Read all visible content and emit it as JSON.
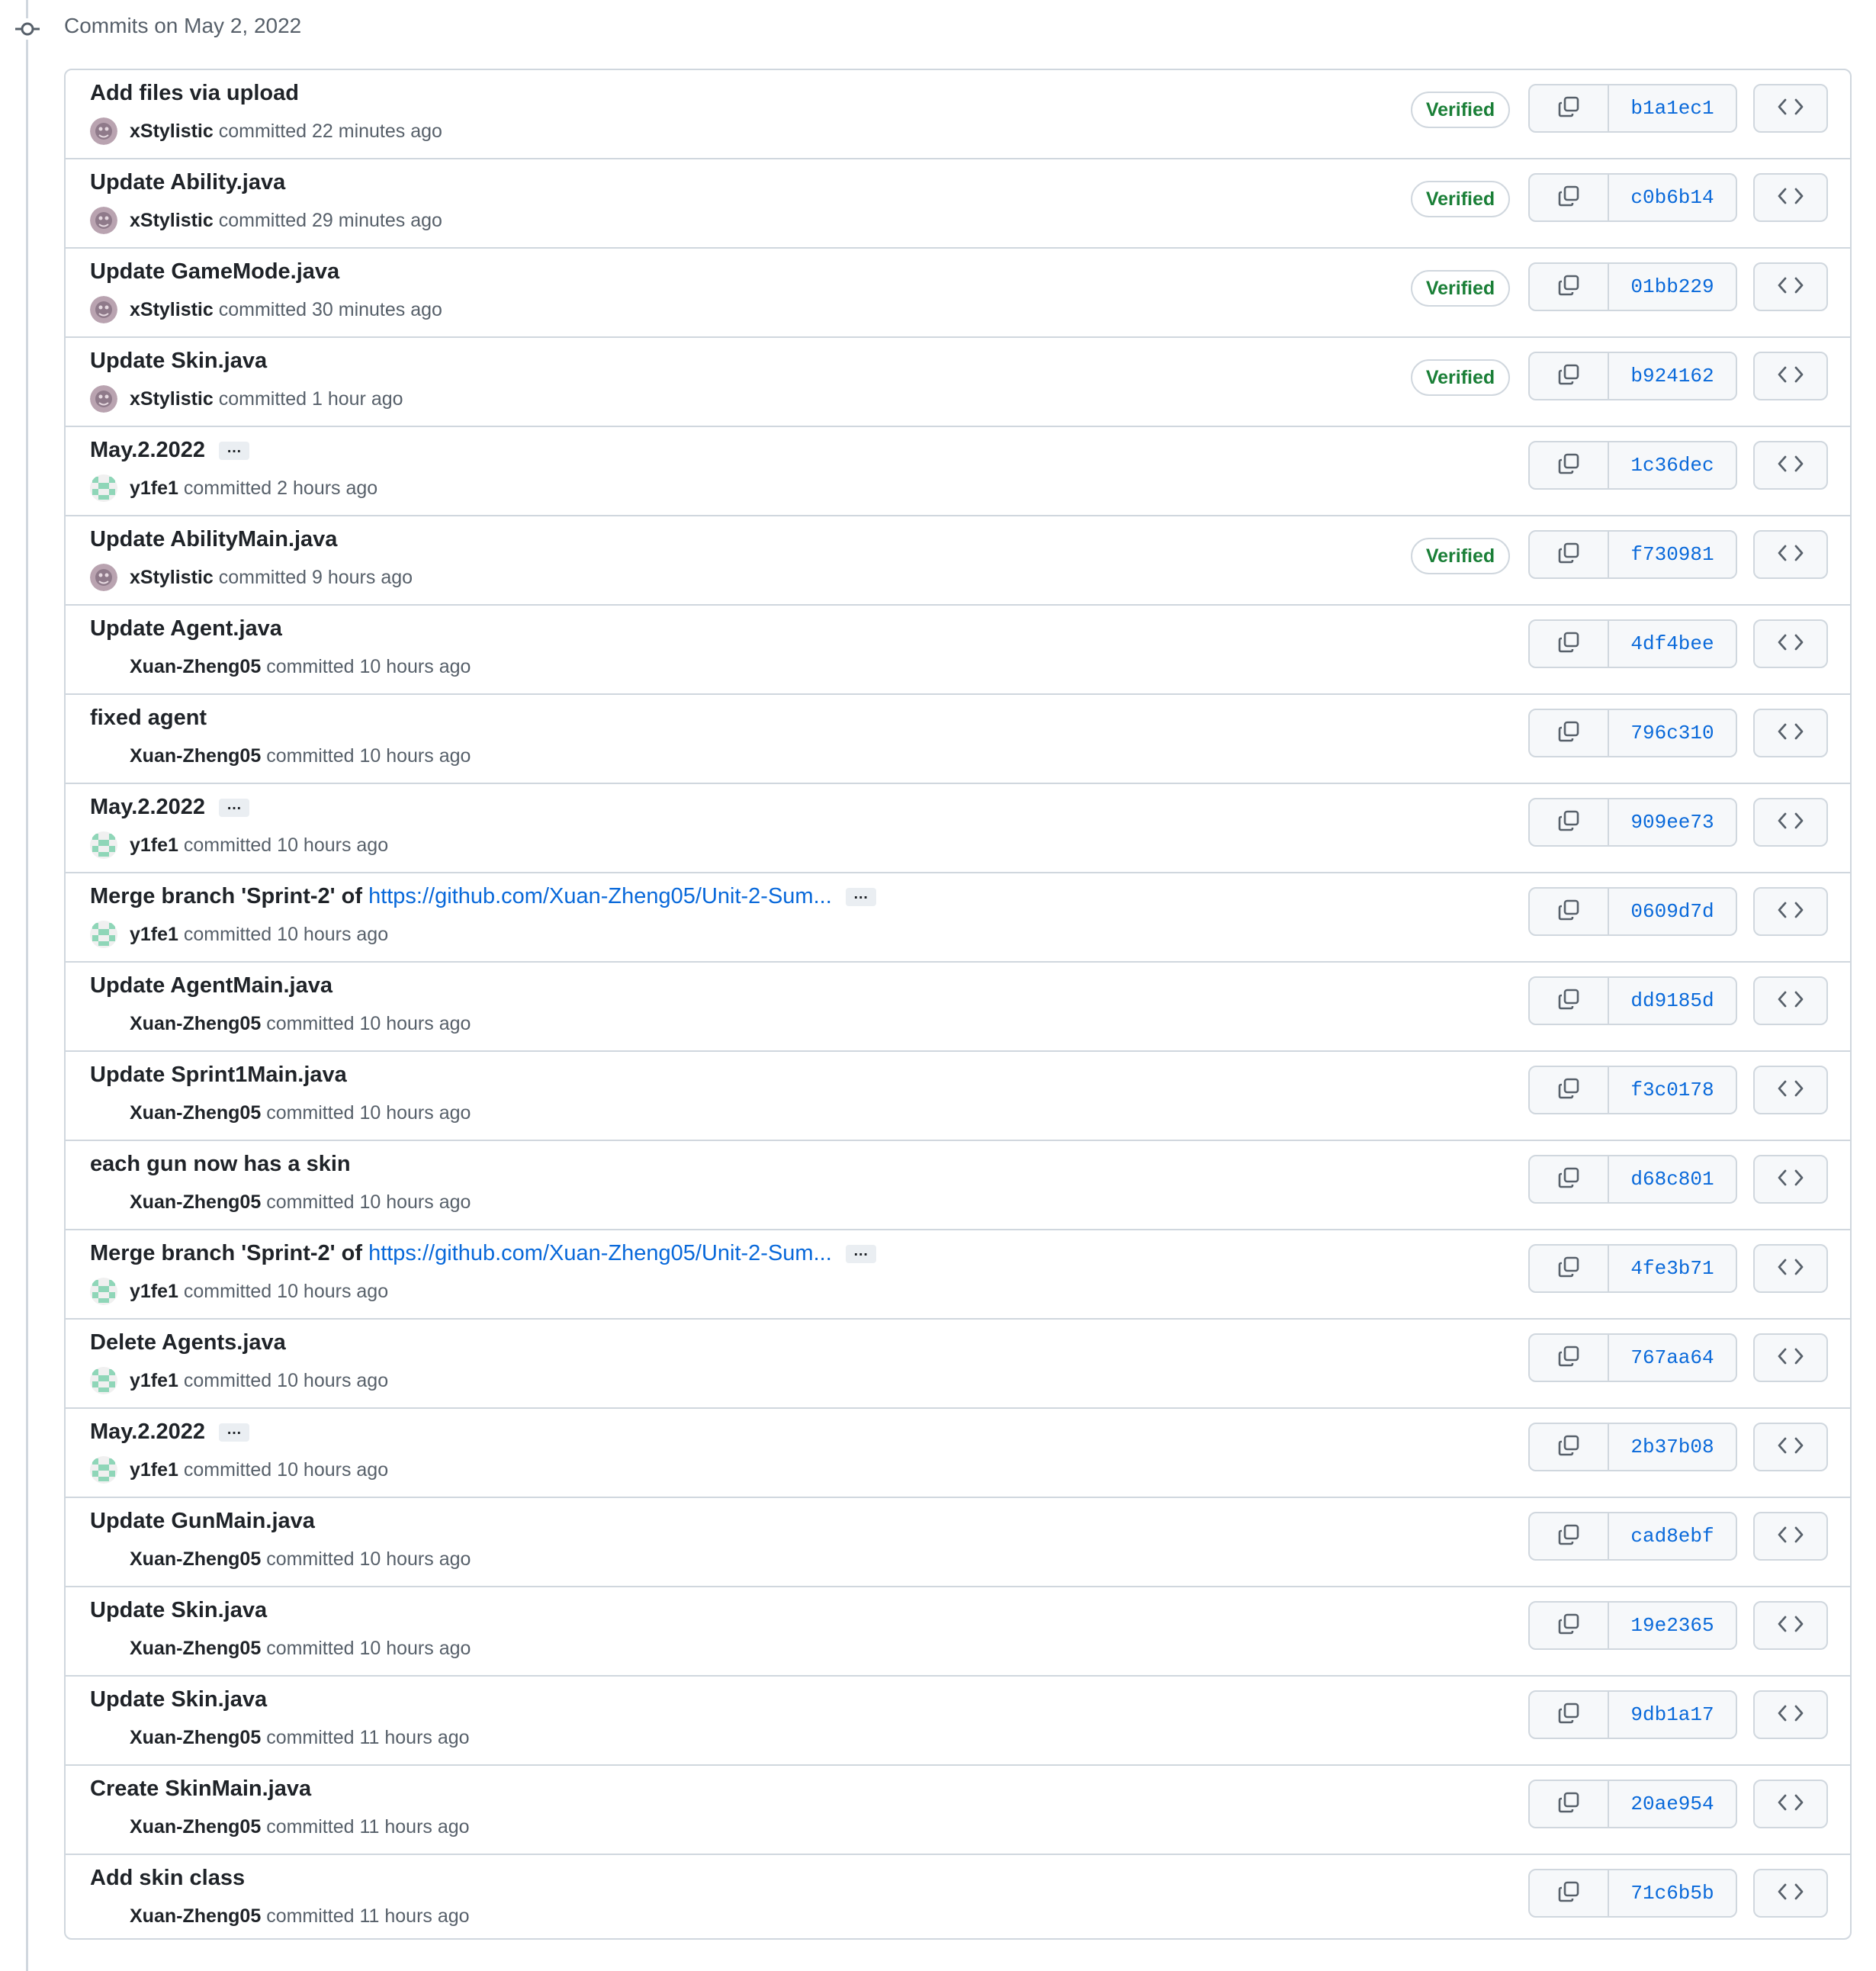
{
  "group": {
    "header": "Commits on May 2, 2022"
  },
  "verified_label": "Verified",
  "colors": {
    "link": "#0969da",
    "verified": "#1a7f37",
    "muted": "#57606a",
    "border": "#d0d7de"
  },
  "icons": {
    "timeline": "git-commit-icon",
    "copy": "copy-icon",
    "browse": "code-icon",
    "more": "kebab-ellipsis-icon"
  },
  "commits": [
    {
      "title": "Add files via upload",
      "link": "",
      "more": false,
      "author": "xStylistic",
      "time": "committed 22 minutes ago",
      "verified": true,
      "sha": "b1a1ec1",
      "avatar": "xstylistic"
    },
    {
      "title": "Update Ability.java",
      "link": "",
      "more": false,
      "author": "xStylistic",
      "time": "committed 29 minutes ago",
      "verified": true,
      "sha": "c0b6b14",
      "avatar": "xstylistic"
    },
    {
      "title": "Update GameMode.java",
      "link": "",
      "more": false,
      "author": "xStylistic",
      "time": "committed 30 minutes ago",
      "verified": true,
      "sha": "01bb229",
      "avatar": "xstylistic"
    },
    {
      "title": "Update Skin.java",
      "link": "",
      "more": false,
      "author": "xStylistic",
      "time": "committed 1 hour ago",
      "verified": true,
      "sha": "b924162",
      "avatar": "xstylistic"
    },
    {
      "title": "May.2.2022",
      "link": "",
      "more": true,
      "author": "y1fe1",
      "time": "committed 2 hours ago",
      "verified": false,
      "sha": "1c36dec",
      "avatar": "y1fe1"
    },
    {
      "title": "Update AbilityMain.java",
      "link": "",
      "more": false,
      "author": "xStylistic",
      "time": "committed 9 hours ago",
      "verified": true,
      "sha": "f730981",
      "avatar": "xstylistic"
    },
    {
      "title": "Update Agent.java",
      "link": "",
      "more": false,
      "author": "Xuan-Zheng05",
      "time": "committed 10 hours ago",
      "verified": false,
      "sha": "4df4bee",
      "avatar": "none"
    },
    {
      "title": "fixed agent",
      "link": "",
      "more": false,
      "author": "Xuan-Zheng05",
      "time": "committed 10 hours ago",
      "verified": false,
      "sha": "796c310",
      "avatar": "none"
    },
    {
      "title": "May.2.2022",
      "link": "",
      "more": true,
      "author": "y1fe1",
      "time": "committed 10 hours ago",
      "verified": false,
      "sha": "909ee73",
      "avatar": "y1fe1"
    },
    {
      "title": "Merge branch 'Sprint-2' of ",
      "link": "https://github.com/Xuan-Zheng05/Unit-2-Sum...",
      "more": true,
      "author": "y1fe1",
      "time": "committed 10 hours ago",
      "verified": false,
      "sha": "0609d7d",
      "avatar": "y1fe1"
    },
    {
      "title": "Update AgentMain.java",
      "link": "",
      "more": false,
      "author": "Xuan-Zheng05",
      "time": "committed 10 hours ago",
      "verified": false,
      "sha": "dd9185d",
      "avatar": "none"
    },
    {
      "title": "Update Sprint1Main.java",
      "link": "",
      "more": false,
      "author": "Xuan-Zheng05",
      "time": "committed 10 hours ago",
      "verified": false,
      "sha": "f3c0178",
      "avatar": "none"
    },
    {
      "title": "each gun now has a skin",
      "link": "",
      "more": false,
      "author": "Xuan-Zheng05",
      "time": "committed 10 hours ago",
      "verified": false,
      "sha": "d68c801",
      "avatar": "none"
    },
    {
      "title": "Merge branch 'Sprint-2' of ",
      "link": "https://github.com/Xuan-Zheng05/Unit-2-Sum...",
      "more": true,
      "author": "y1fe1",
      "time": "committed 10 hours ago",
      "verified": false,
      "sha": "4fe3b71",
      "avatar": "y1fe1"
    },
    {
      "title": "Delete Agents.java",
      "link": "",
      "more": false,
      "author": "y1fe1",
      "time": "committed 10 hours ago",
      "verified": false,
      "sha": "767aa64",
      "avatar": "y1fe1"
    },
    {
      "title": "May.2.2022",
      "link": "",
      "more": true,
      "author": "y1fe1",
      "time": "committed 10 hours ago",
      "verified": false,
      "sha": "2b37b08",
      "avatar": "y1fe1"
    },
    {
      "title": "Update GunMain.java",
      "link": "",
      "more": false,
      "author": "Xuan-Zheng05",
      "time": "committed 10 hours ago",
      "verified": false,
      "sha": "cad8ebf",
      "avatar": "none"
    },
    {
      "title": "Update Skin.java",
      "link": "",
      "more": false,
      "author": "Xuan-Zheng05",
      "time": "committed 10 hours ago",
      "verified": false,
      "sha": "19e2365",
      "avatar": "none"
    },
    {
      "title": "Update Skin.java",
      "link": "",
      "more": false,
      "author": "Xuan-Zheng05",
      "time": "committed 11 hours ago",
      "verified": false,
      "sha": "9db1a17",
      "avatar": "none"
    },
    {
      "title": "Create SkinMain.java",
      "link": "",
      "more": false,
      "author": "Xuan-Zheng05",
      "time": "committed 11 hours ago",
      "verified": false,
      "sha": "20ae954",
      "avatar": "none"
    },
    {
      "title": "Add skin class",
      "link": "",
      "more": false,
      "author": "Xuan-Zheng05",
      "time": "committed 11 hours ago",
      "verified": false,
      "sha": "71c6b5b",
      "avatar": "none"
    }
  ]
}
